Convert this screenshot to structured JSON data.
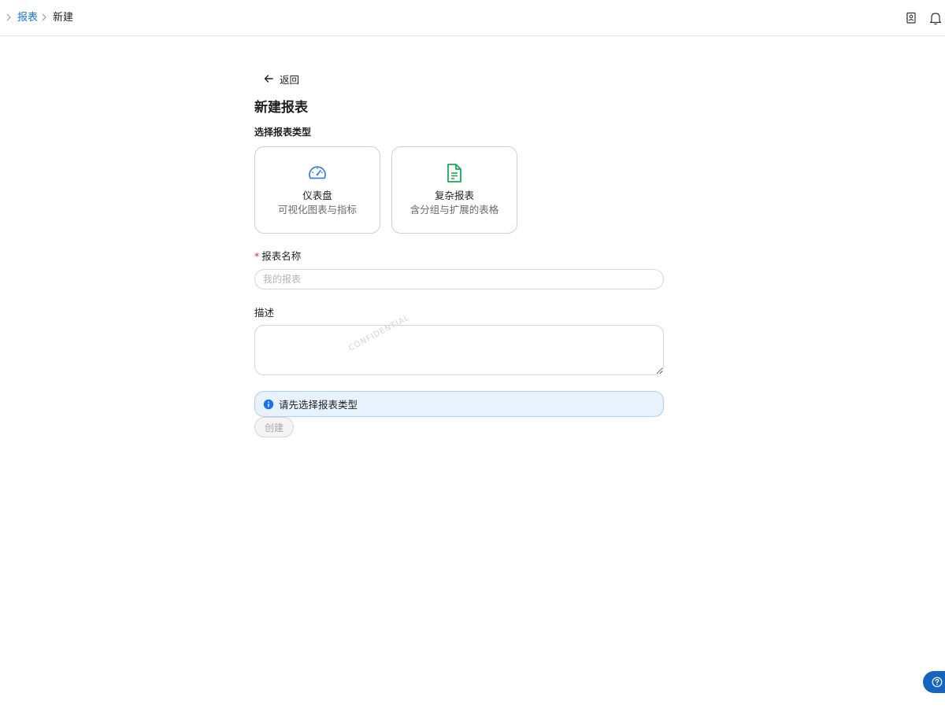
{
  "breadcrumb": {
    "items": [
      {
        "label": "报表",
        "link": true
      },
      {
        "label": "新建",
        "link": false
      }
    ]
  },
  "header": {
    "icons": [
      "contacts-icon",
      "bell-icon"
    ]
  },
  "page": {
    "back_label": "返回",
    "title": "新建报表",
    "type_section_label": "选择报表类型"
  },
  "report_types": [
    {
      "title": "仪表盘",
      "description": "可视化图表与指标",
      "icon": "speedometer-icon",
      "color": "#3b82d6"
    },
    {
      "title": "复杂报表",
      "description": "含分组与扩展的表格",
      "icon": "document-icon",
      "color": "#1aaa55"
    }
  ],
  "form": {
    "name_label": "报表名称",
    "name_required_mark": "*",
    "name_placeholder": "我的报表",
    "name_value": "",
    "description_label": "描述",
    "description_value": "",
    "watermark": "CONFIDENTIAL"
  },
  "alert": {
    "message": "请先选择报表类型",
    "type": "info",
    "color": "#1a73e8"
  },
  "actions": {
    "create_label": "创建",
    "create_disabled": true
  },
  "colors": {
    "accent": "#1a73e8",
    "help_fab": "#1565c0"
  }
}
